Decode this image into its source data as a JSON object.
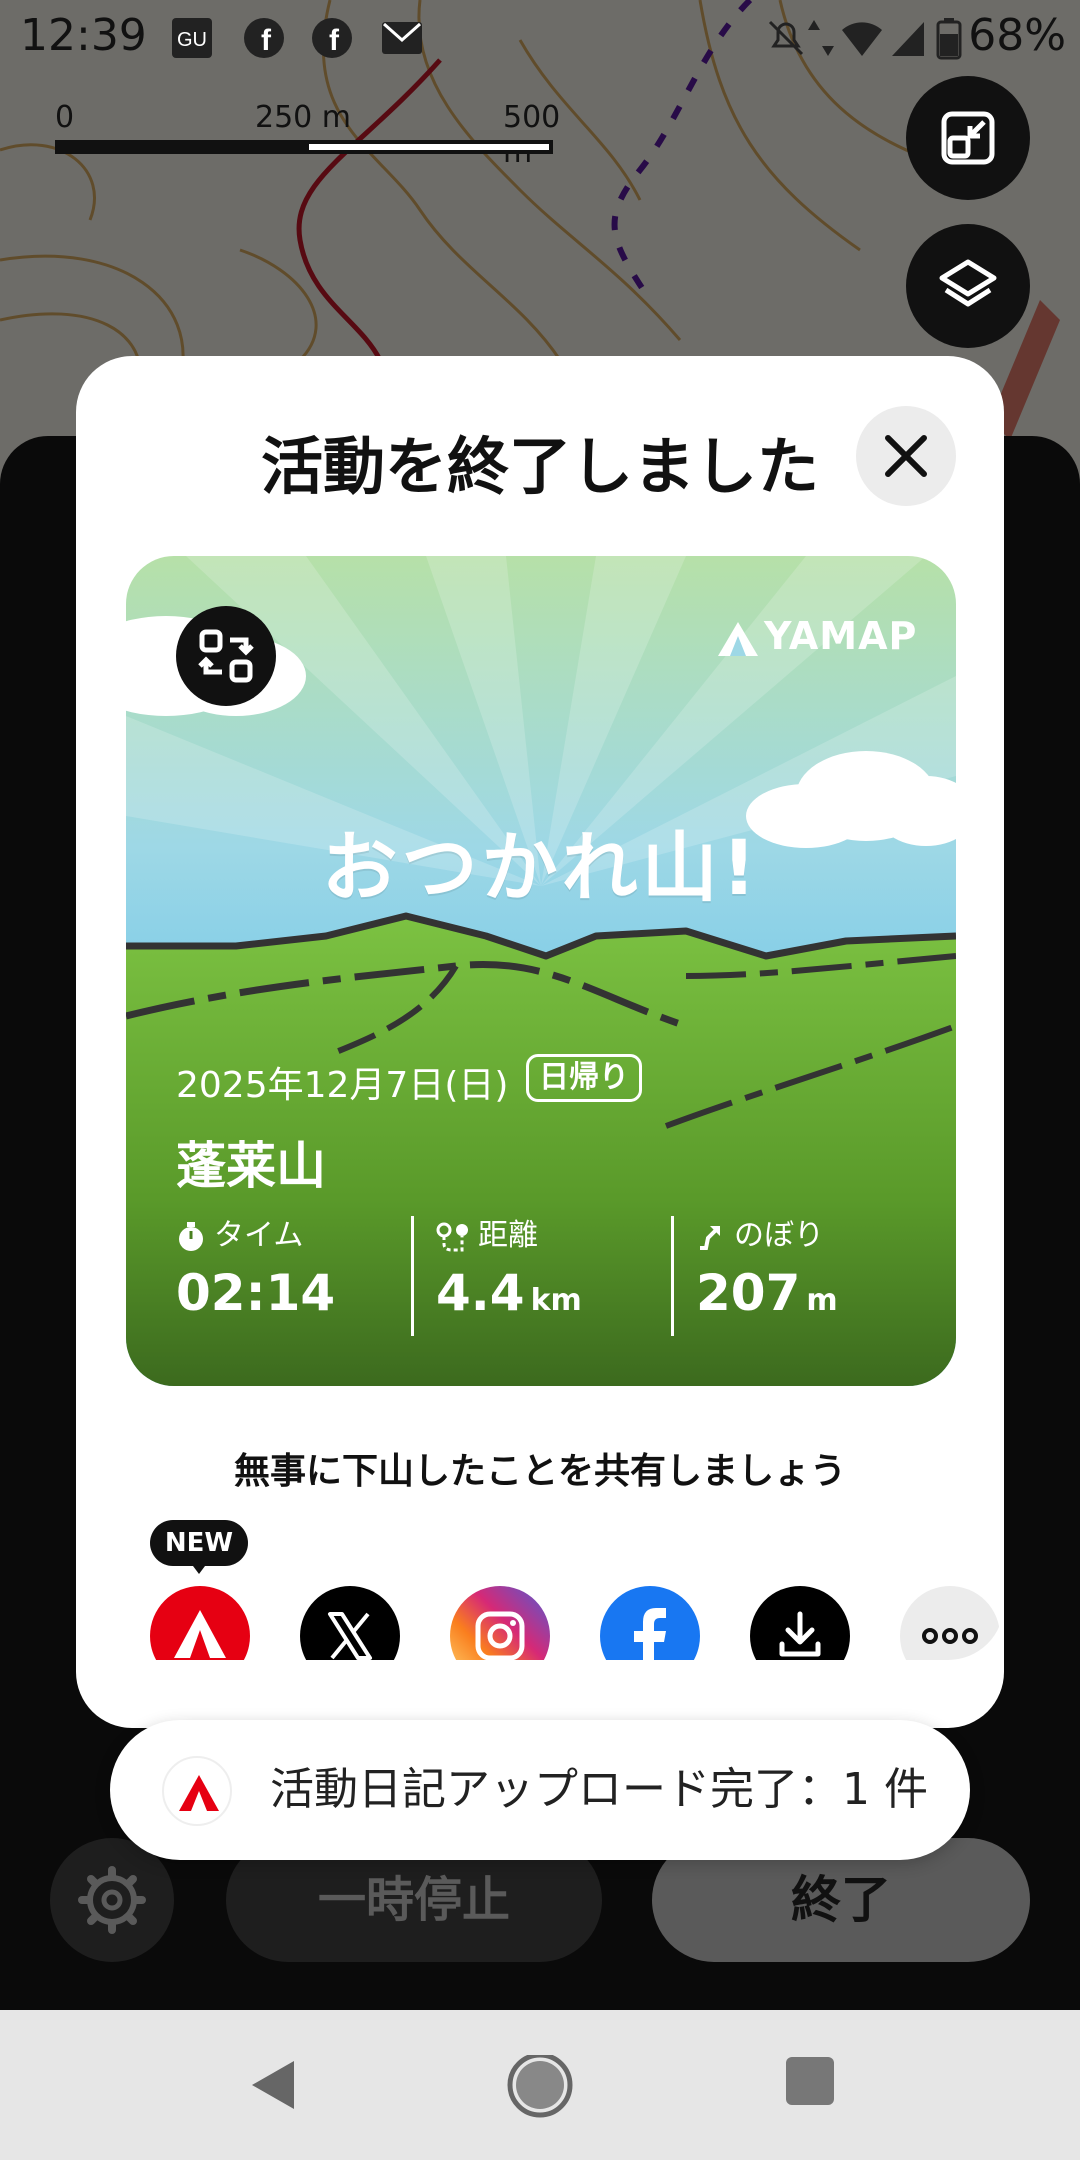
{
  "status_bar": {
    "time": "12:39",
    "battery": "68%",
    "icons": [
      "gunosy-icon",
      "facebook-icon",
      "facebook-icon",
      "au-mail-icon",
      "mute-icon",
      "data-arrows-icon",
      "wifi-icon",
      "signal-icon",
      "battery-icon"
    ]
  },
  "map": {
    "scale_labels": [
      "0",
      "250 m",
      "500 m"
    ]
  },
  "modal": {
    "title": "活動を終了しました",
    "card": {
      "brand": "YAMAP",
      "headline": "おつかれ山!",
      "date": "2025年12月7日(日)",
      "badge": "日帰り",
      "mountain": "蓬莱山",
      "stats": [
        {
          "label": "タイム",
          "value": "02:14",
          "unit": "",
          "icon": "stopwatch-icon"
        },
        {
          "label": "距離",
          "value": "4.4",
          "unit": "km",
          "icon": "route-icon"
        },
        {
          "label": "のぼり",
          "value": "207",
          "unit": "m",
          "icon": "ascent-icon"
        }
      ]
    },
    "share_prompt": "無事に下山したことを共有しましょう",
    "new_badge": "NEW",
    "share_targets": [
      "yamap",
      "x",
      "instagram",
      "facebook",
      "download",
      "more"
    ]
  },
  "toast": {
    "text": "活動日記アップロード完了：1 件"
  },
  "controls": {
    "pause_label": "一時停止",
    "end_label": "終了"
  },
  "colors": {
    "yamap_red": "#e60012",
    "facebook_blue": "#1877f2",
    "sky_top": "#bfe3f0",
    "grass_dark": "#3c6a1e"
  }
}
